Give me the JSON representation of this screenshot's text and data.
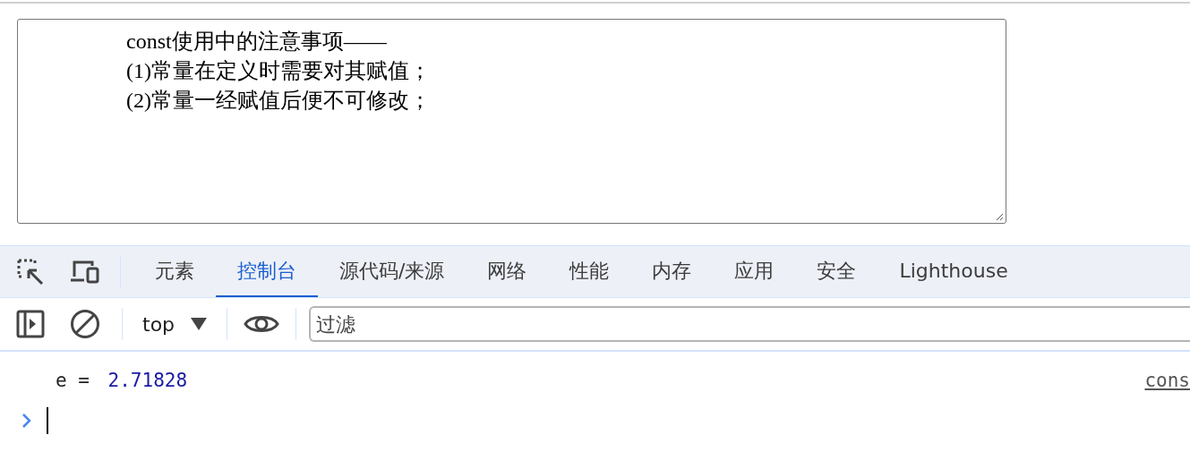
{
  "page_textarea": {
    "lines": [
      "const使用中的注意事项——",
      "(1)常量在定义时需要对其赋值；",
      "(2)常量一经赋值后便不可修改；"
    ]
  },
  "devtools": {
    "tabs": [
      {
        "label": "元素",
        "selected": false
      },
      {
        "label": "控制台",
        "selected": true
      },
      {
        "label": "源代码/来源",
        "selected": false
      },
      {
        "label": "网络",
        "selected": false
      },
      {
        "label": "性能",
        "selected": false
      },
      {
        "label": "内存",
        "selected": false
      },
      {
        "label": "应用",
        "selected": false
      },
      {
        "label": "安全",
        "selected": false
      },
      {
        "label": "Lighthouse",
        "selected": false
      }
    ],
    "toolbar": {
      "context": "top",
      "filter": {
        "placeholder": "过滤"
      }
    },
    "console": {
      "messages": [
        {
          "name": "e = ",
          "value": "2.71828",
          "source": "cons"
        }
      ]
    }
  }
}
